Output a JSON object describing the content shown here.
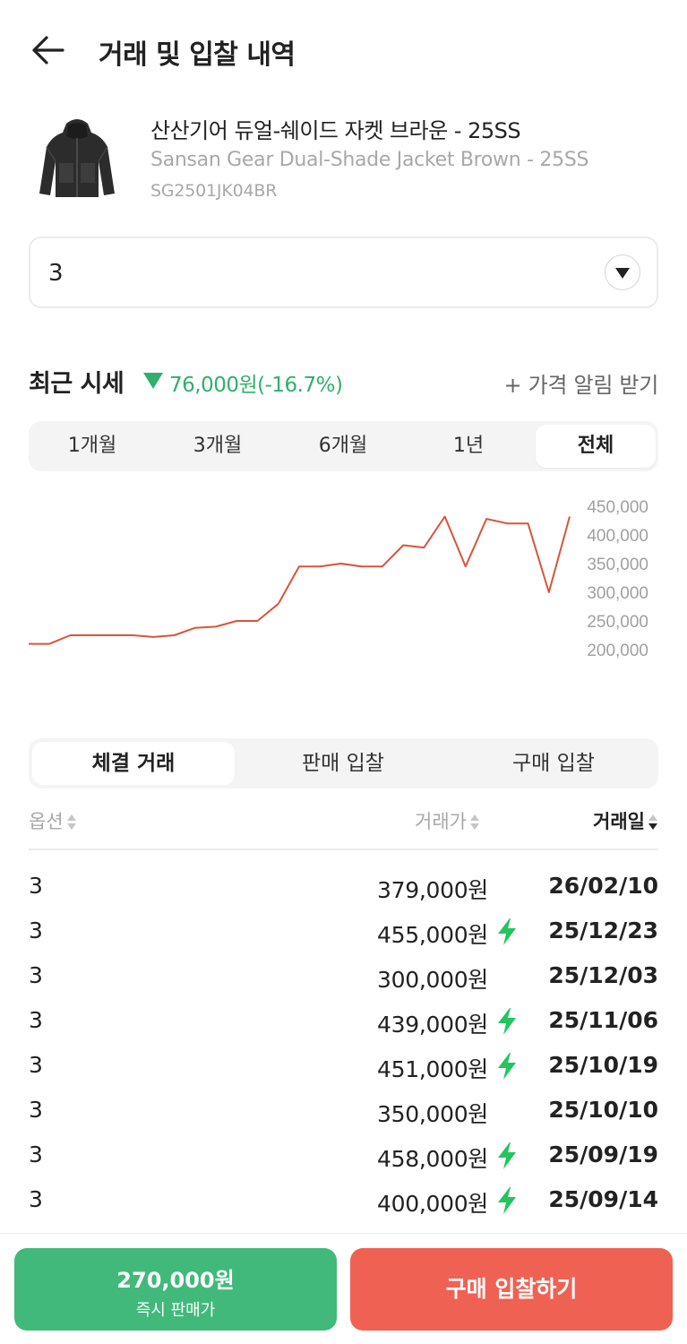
{
  "header": {
    "title": "거래 및 입찰 내역"
  },
  "product": {
    "name_ko": "산산기어 듀얼-쉐이드 자켓 브라운 - 25SS",
    "name_en": "Sansan Gear Dual-Shade Jacket Brown - 25SS",
    "code": "SG2501JK04BR"
  },
  "size_select": {
    "value": "3"
  },
  "market": {
    "title": "최근 시세",
    "change": "76,000원(-16.7%)",
    "alert_label": "+ 가격 알림 받기",
    "change_color": "#2faf6b"
  },
  "period_tabs": [
    "1개월",
    "3개월",
    "6개월",
    "1년",
    "전체"
  ],
  "period_active": "전체",
  "chart_data": {
    "type": "line",
    "y_ticks": [
      "450,000",
      "400,000",
      "350,000",
      "300,000",
      "250,000",
      "200,000"
    ],
    "ylim": [
      200000,
      450000
    ],
    "xlabel": "",
    "ylabel": "",
    "line_color": "#d6553a",
    "values": [
      210000,
      210000,
      225000,
      225000,
      225000,
      225000,
      222000,
      225000,
      238000,
      240000,
      250000,
      250000,
      280000,
      345000,
      345000,
      350000,
      345000,
      345000,
      382000,
      378000,
      432000,
      345000,
      428000,
      420000,
      420000,
      300000,
      432000
    ]
  },
  "trade_tabs": [
    "체결 거래",
    "판매 입찰",
    "구매 입찰"
  ],
  "trade_active": "체결 거래",
  "table": {
    "headers": {
      "option": "옵션",
      "price": "거래가",
      "date": "거래일"
    },
    "rows": [
      {
        "option": "3",
        "price": "379,000원",
        "quick": false,
        "date": "26/02/10"
      },
      {
        "option": "3",
        "price": "455,000원",
        "quick": true,
        "date": "25/12/23"
      },
      {
        "option": "3",
        "price": "300,000원",
        "quick": false,
        "date": "25/12/03"
      },
      {
        "option": "3",
        "price": "439,000원",
        "quick": true,
        "date": "25/11/06"
      },
      {
        "option": "3",
        "price": "451,000원",
        "quick": true,
        "date": "25/10/19"
      },
      {
        "option": "3",
        "price": "350,000원",
        "quick": false,
        "date": "25/10/10"
      },
      {
        "option": "3",
        "price": "458,000원",
        "quick": true,
        "date": "25/09/19"
      },
      {
        "option": "3",
        "price": "400,000원",
        "quick": true,
        "date": "25/09/14"
      }
    ]
  },
  "bottom": {
    "sell_price": "270,000원",
    "sell_label": "즉시 판매가",
    "buy_label": "구매 입찰하기",
    "sell_color": "#41b97b",
    "buy_color": "#ef6253"
  },
  "icons": {
    "back": "arrow-left-icon",
    "dropdown": "chevron-down-icon",
    "quick": "lightning-bolt-icon",
    "down": "triangle-down-icon"
  }
}
